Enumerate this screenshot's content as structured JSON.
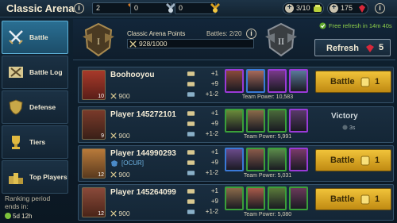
{
  "header": {
    "title": "Classic Arena",
    "resources": [
      {
        "value": "2",
        "icon": "bronze-medal-icon"
      },
      {
        "value": "0",
        "icon": "silver-medal-icon"
      },
      {
        "value": "0",
        "icon": "gold-medal-icon"
      }
    ],
    "energy": "3/10",
    "gems": "175"
  },
  "sidebar": {
    "items": [
      {
        "label": "Battle",
        "icon": "crossed-swords-icon",
        "active": true
      },
      {
        "label": "Battle Log",
        "icon": "crossed-axes-icon"
      },
      {
        "label": "Defense",
        "icon": "shield-icon"
      },
      {
        "label": "Tiers",
        "icon": "trophy-icon"
      },
      {
        "label": "Top Players",
        "icon": "podium-icon"
      }
    ],
    "ranking_label": "Ranking period ends in:",
    "ranking_time": "5d 12h"
  },
  "arena": {
    "points_title": "Classic Arena Points",
    "points_value": "928/1000",
    "battles": "Battles: 2/20",
    "refresh_note": "Free refresh in 14m 40s",
    "refresh_label": "Refresh",
    "refresh_cost": "5"
  },
  "opponents": [
    {
      "name": "Boohooyou",
      "level": "10",
      "points": "900",
      "tag": "",
      "stats": [
        "+1",
        "+9",
        "+1-2"
      ],
      "power": "Team Power: 10,583",
      "status": "battle",
      "button": "Battle",
      "cost": "1"
    },
    {
      "name": "Player 145272101",
      "level": "9",
      "points": "900",
      "tag": "",
      "stats": [
        "+1",
        "+9",
        "+1-2"
      ],
      "power": "Team Power: 5,991",
      "status": "victory",
      "victory": "Victory",
      "victory_time": "3s"
    },
    {
      "name": "Player 144990293",
      "level": "12",
      "points": "900",
      "tag": "[OCUR]",
      "stats": [
        "+1",
        "+9",
        "+1-2"
      ],
      "power": "Team Power: 5,031",
      "status": "battle",
      "button": "Battle",
      "cost": "1"
    },
    {
      "name": "Player 145264099",
      "level": "12",
      "points": "900",
      "tag": "",
      "stats": [
        "+1",
        "+9",
        "+1-2"
      ],
      "power": "Team Power: 5,080",
      "status": "battle",
      "button": "Battle",
      "cost": "1"
    }
  ],
  "colors": {
    "accent": "#f0c33a",
    "active_tab": "#2a6f93",
    "green_text": "#8fd14a"
  }
}
